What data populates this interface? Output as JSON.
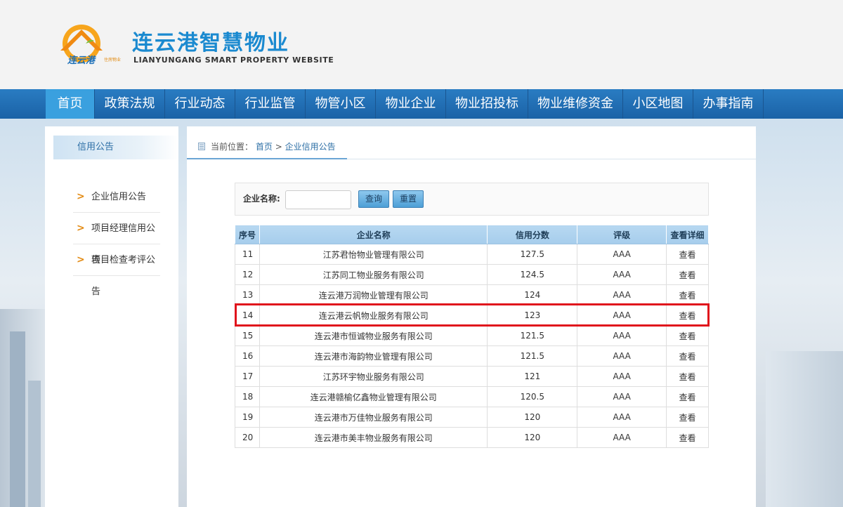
{
  "header": {
    "title": "连云港智慧物业",
    "subtitle": "LIANYUNGANG SMART PROPERTY WEBSITE",
    "logo_text": "连云港",
    "logo_small": "住房物业"
  },
  "nav": {
    "items": [
      {
        "label": "首页",
        "active": true
      },
      {
        "label": "政策法规"
      },
      {
        "label": "行业动态"
      },
      {
        "label": "行业监管"
      },
      {
        "label": "物管小区"
      },
      {
        "label": "物业企业"
      },
      {
        "label": "物业招投标"
      },
      {
        "label": "物业维修资金"
      },
      {
        "label": "小区地图"
      },
      {
        "label": "办事指南"
      }
    ]
  },
  "sidebar": {
    "heading": "信用公告",
    "items": [
      {
        "label": "企业信用公告"
      },
      {
        "label": "项目经理信用公告"
      },
      {
        "label": "项目检查考评公告"
      }
    ],
    "arrow": ">"
  },
  "breadcrumb": {
    "prefix": "当前位置：",
    "home": "首页",
    "sep": ">",
    "current": "企业信用公告"
  },
  "search": {
    "label": "企业名称:",
    "value": "",
    "query_label": "查询",
    "reset_label": "重置"
  },
  "table": {
    "headers": [
      "序号",
      "企业名称",
      "信用分数",
      "评级",
      "查看详细"
    ],
    "rows": [
      {
        "no": "11",
        "name": "江苏君怡物业管理有限公司",
        "score": "127.5",
        "grade": "AAA",
        "action": "查看"
      },
      {
        "no": "12",
        "name": "江苏同工物业服务有限公司",
        "score": "124.5",
        "grade": "AAA",
        "action": "查看"
      },
      {
        "no": "13",
        "name": "连云港万润物业管理有限公司",
        "score": "124",
        "grade": "AAA",
        "action": "查看"
      },
      {
        "no": "14",
        "name": "连云港云帆物业服务有限公司",
        "score": "123",
        "grade": "AAA",
        "action": "查看",
        "highlighted": true
      },
      {
        "no": "15",
        "name": "连云港市恒诚物业服务有限公司",
        "score": "121.5",
        "grade": "AAA",
        "action": "查看"
      },
      {
        "no": "16",
        "name": "连云港市海韵物业管理有限公司",
        "score": "121.5",
        "grade": "AAA",
        "action": "查看"
      },
      {
        "no": "17",
        "name": "江苏环宇物业服务有限公司",
        "score": "121",
        "grade": "AAA",
        "action": "查看"
      },
      {
        "no": "18",
        "name": "连云港赣榆亿鑫物业管理有限公司",
        "score": "120.5",
        "grade": "AAA",
        "action": "查看"
      },
      {
        "no": "19",
        "name": "连云港市万佳物业服务有限公司",
        "score": "120",
        "grade": "AAA",
        "action": "查看"
      },
      {
        "no": "20",
        "name": "连云港市美丰物业服务有限公司",
        "score": "120",
        "grade": "AAA",
        "action": "查看"
      }
    ]
  },
  "colors": {
    "brand": "#1b8ad0",
    "nav": "#1f6cb0",
    "nav_active": "#3aa0df",
    "highlight": "#e0141c"
  }
}
